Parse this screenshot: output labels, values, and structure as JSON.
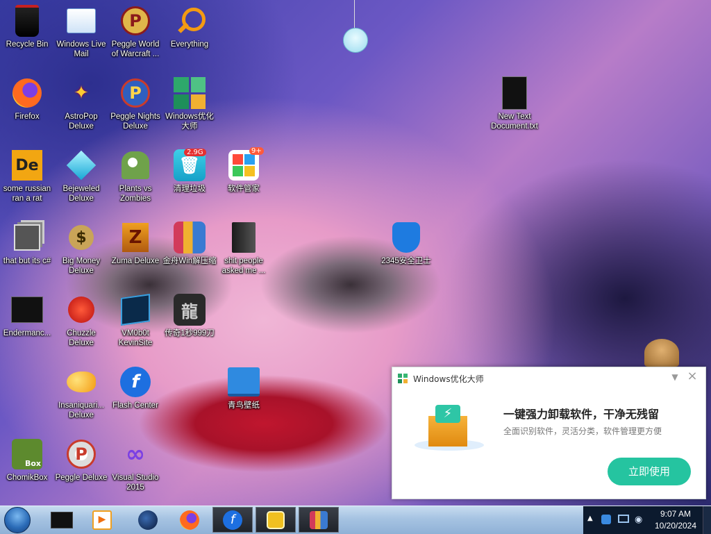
{
  "desktop": {
    "icons": [
      {
        "label": "Recycle Bin",
        "icon": "recycle-bin-icon"
      },
      {
        "label": "Windows Live Mail",
        "icon": "mail-icon"
      },
      {
        "label": "Peggle World of Warcraft ...",
        "icon": "peggle-icon"
      },
      {
        "label": "Everything",
        "icon": "search-magnifier-icon"
      },
      {
        "label": "Firefox",
        "icon": "firefox-icon"
      },
      {
        "label": "AstroPop Deluxe",
        "icon": "astropop-icon"
      },
      {
        "label": "Peggle Nights Deluxe",
        "icon": "peggle-nights-icon"
      },
      {
        "label": "Windows优化大师",
        "icon": "windows-optimizer-icon"
      },
      {
        "label": "New Text Document.txt",
        "icon": "text-document-icon"
      },
      {
        "label": "some russian ran a rat",
        "icon": "de-icon"
      },
      {
        "label": "Bejeweled Deluxe",
        "icon": "diamond-icon"
      },
      {
        "label": "Plants vs Zombies",
        "icon": "plants-vs-zombies-icon"
      },
      {
        "label": "清理垃圾",
        "icon": "trash-clean-icon",
        "badge": "2.9G"
      },
      {
        "label": "软件管家",
        "icon": "software-manager-icon",
        "badge": "9+"
      },
      {
        "label": "that but its c#",
        "icon": "windows-stack-icon"
      },
      {
        "label": "Big Money Deluxe",
        "icon": "money-bag-icon"
      },
      {
        "label": "Zuma Deluxe",
        "icon": "zuma-icon"
      },
      {
        "label": "金舟Win解压缩",
        "icon": "archive-icon"
      },
      {
        "label": "shit people asked me ...",
        "icon": "folder-icon"
      },
      {
        "label": "2345安全卫士",
        "icon": "shield-user-icon"
      },
      {
        "label": "Endermanc...",
        "icon": "terminal-icon"
      },
      {
        "label": "Chuzzle Deluxe",
        "icon": "chuzzle-icon"
      },
      {
        "label": "VM0b0t KevinSite",
        "icon": "vm-icon"
      },
      {
        "label": "传奇1秒999刀",
        "icon": "legend-game-icon"
      },
      {
        "label": "Insaniquari... Deluxe",
        "icon": "goldfish-icon"
      },
      {
        "label": "Flash Center",
        "icon": "flash-icon"
      },
      {
        "label": "青鸟壁纸",
        "icon": "wallpaper-icon"
      },
      {
        "label": "ChomikBox",
        "icon": "chomikbox-icon"
      },
      {
        "label": "Peggle Deluxe",
        "icon": "peggle-deluxe-icon"
      },
      {
        "label": "Visual Studio 2015",
        "icon": "visual-studio-icon"
      }
    ]
  },
  "popup": {
    "title": "Windows优化大师",
    "headline": "一键强力卸载软件，干净无残留",
    "subtitle": "全面识别软件，灵活分类，软件管理更方便",
    "button_label": "立即使用"
  },
  "taskbar": {
    "items": [
      "start-orb-icon",
      "black-box-icon",
      "media-player-icon",
      "globe-icon",
      "firefox-icon",
      "flash-icon",
      "security-app-icon",
      "archive-icon"
    ],
    "clock": {
      "time": "9:07 AM",
      "date": "10/20/2024"
    }
  },
  "colors": {
    "popup_button": "#25c4a0",
    "taskbar": "#a6c3e2"
  }
}
